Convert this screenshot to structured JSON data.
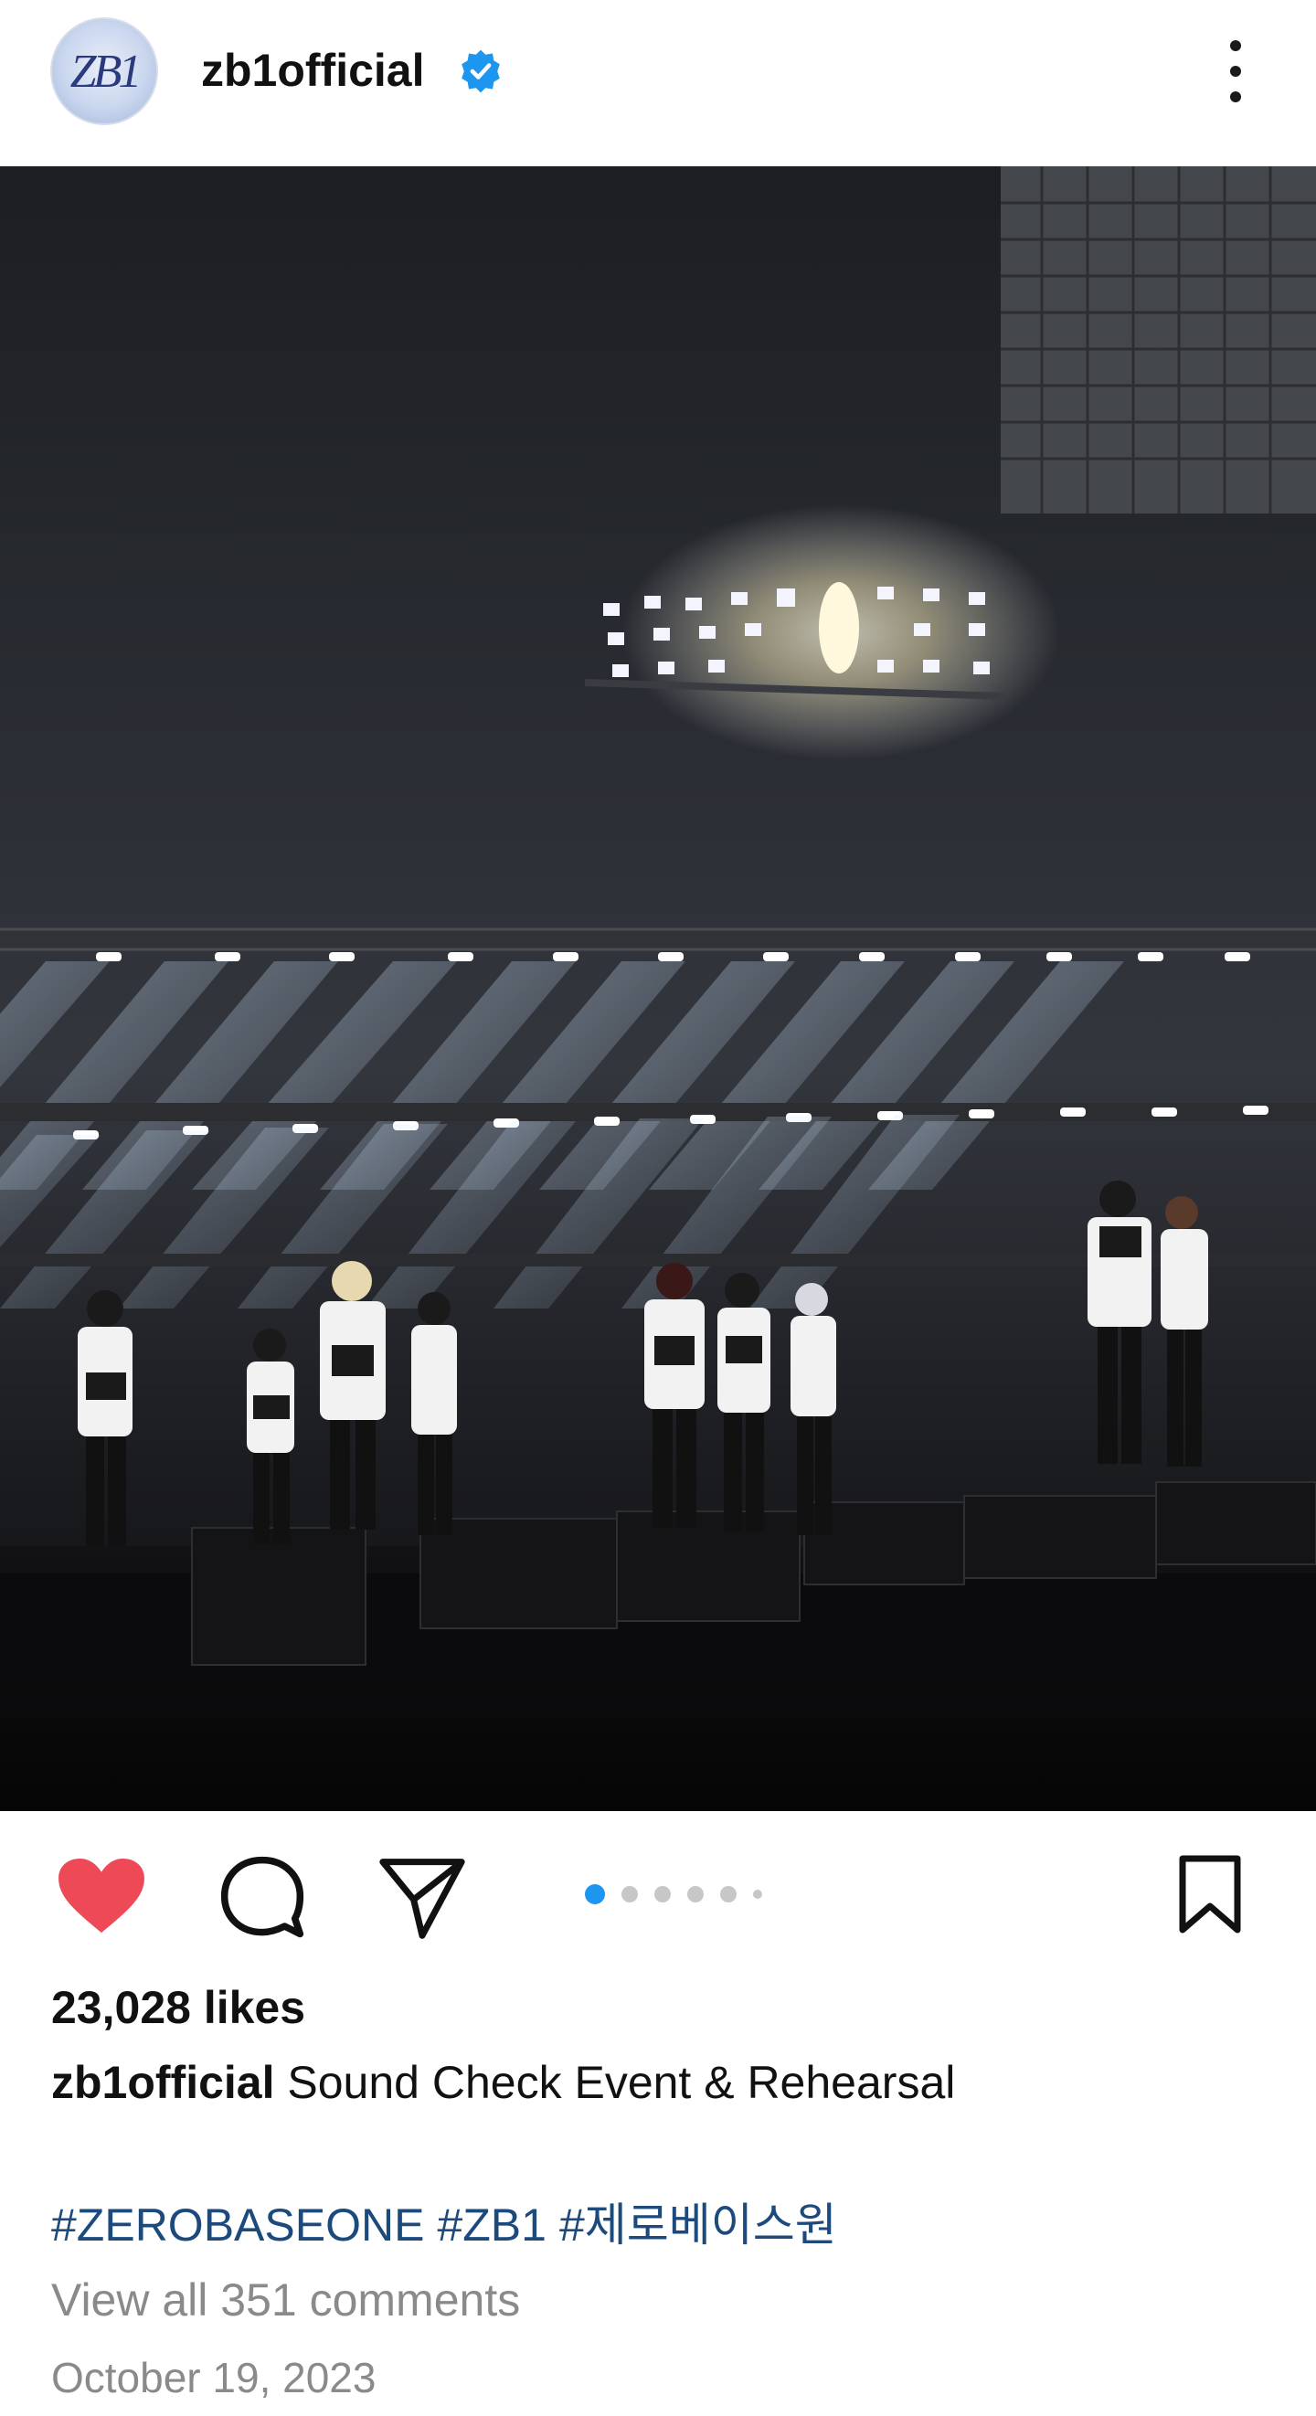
{
  "header": {
    "avatar_text": "ZB1",
    "username": "zb1official",
    "verified_icon": "verified-badge-icon",
    "more_icon": "more-vertical-icon"
  },
  "post": {
    "image_alt": "Stage rehearsal photo",
    "carousel": {
      "total": 6,
      "current": 1
    }
  },
  "actions": {
    "like_icon": "heart-filled-icon",
    "comment_icon": "comment-icon",
    "share_icon": "send-icon",
    "save_icon": "bookmark-icon",
    "liked_color": "#ed4956",
    "active_dot_color": "#1d96f0"
  },
  "likes": "23,028 likes",
  "caption": {
    "username": "zb1official",
    "text": " Sound Check Event & Rehearsal"
  },
  "hashtags": [
    "#ZEROBASEONE",
    "#ZB1",
    "#제로베이스원"
  ],
  "comments_link": "View all 351 comments",
  "date": "October 19, 2023"
}
